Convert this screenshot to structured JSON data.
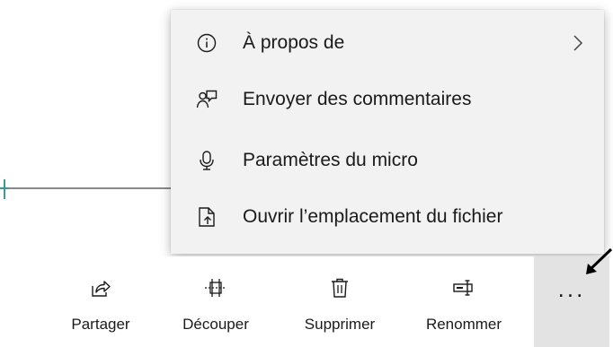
{
  "menu": {
    "items": [
      {
        "label": "À propos de",
        "icon": "info-icon",
        "has_submenu": true
      },
      {
        "label": "Envoyer des commentaires",
        "icon": "feedback-icon",
        "has_submenu": false
      },
      {
        "label": "Paramètres du micro",
        "icon": "microphone-icon",
        "has_submenu": false
      },
      {
        "label": "Ouvrir l’emplacement du fichier",
        "icon": "open-file-location-icon",
        "has_submenu": false
      }
    ]
  },
  "toolbar": {
    "share_label": "Partager",
    "trim_label": "Découper",
    "delete_label": "Supprimer",
    "rename_label": "Renommer",
    "more_label": "...",
    "more_bg": "#e3e3e3"
  },
  "colors": {
    "menu_bg": "#f2f2f2",
    "timeline": "#8a8a8a",
    "playhead": "#3a9a9a"
  }
}
